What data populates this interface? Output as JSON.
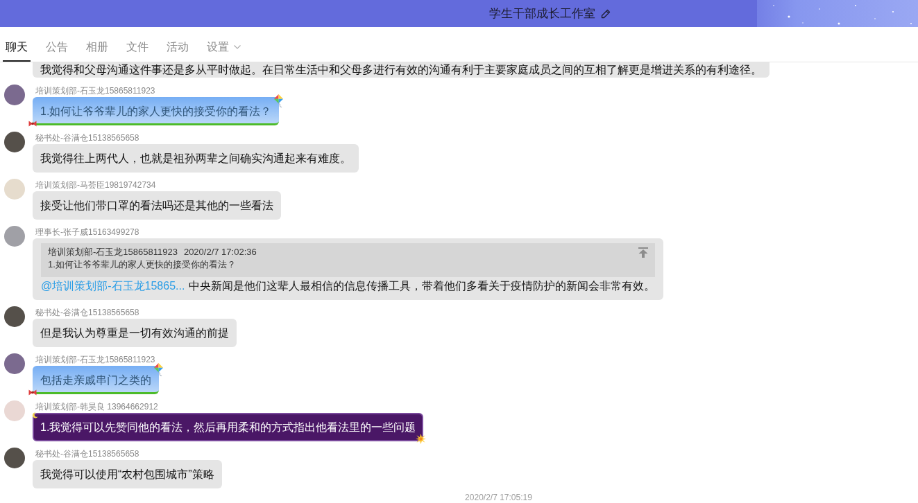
{
  "header": {
    "title": "学生干部成长工作室"
  },
  "tabs": [
    {
      "label": "聊天",
      "selected": true,
      "has_menu": false
    },
    {
      "label": "公告",
      "selected": false,
      "has_menu": false
    },
    {
      "label": "相册",
      "selected": false,
      "has_menu": false
    },
    {
      "label": "文件",
      "selected": false,
      "has_menu": false
    },
    {
      "label": "活动",
      "selected": false,
      "has_menu": false
    },
    {
      "label": "设置",
      "selected": false,
      "has_menu": true
    }
  ],
  "chat": {
    "messages": [
      {
        "kind": "plain",
        "text": "我觉得和父母沟通这件事还是多从平时做起。在日常生活中和父母多进行有效的沟通有利于主要家庭成员之间的互相了解更是增进关系的有利途径。"
      },
      {
        "kind": "sky",
        "sender": "培训策划部-石玉龙15865811923",
        "avatar": {
          "color": "#7b6a8f"
        },
        "text": "1.如何让爷爷辈儿的家人更快的接受你的看法？"
      },
      {
        "kind": "plain",
        "sender": "秘书处-谷满仓15138565658",
        "avatar": {
          "color": "#55504a"
        },
        "text": "我觉得往上两代人，也就是祖孙两辈之间确实沟通起来有难度。"
      },
      {
        "kind": "plain",
        "sender": "培训策划部-马荟臣19819742734",
        "avatar": {
          "color": "#e6dccd"
        },
        "text": "接受让他们带口罩的看法吗还是其他的一些看法"
      },
      {
        "kind": "plain",
        "sender": "理事长-张子威15163499278",
        "avatar": {
          "color": "#a0a0a6"
        },
        "quote": {
          "sender": "培训策划部-石玉龙15865811923",
          "time": "2020/2/7 17:02:36",
          "text": "1.如何让爷爷辈儿的家人更快的接受你的看法？"
        },
        "mention": "@培训策划部-石玉龙15865...",
        "text": "中央新闻是他们这辈人最相信的信息传播工具，带着他们多看关于疫情防护的新闻会非常有效。"
      },
      {
        "kind": "plain",
        "sender": "秘书处-谷满仓15138565658",
        "avatar": {
          "color": "#55504a"
        },
        "text": "但是我认为尊重是一切有效沟通的前提"
      },
      {
        "kind": "sky",
        "sender": "培训策划部-石玉龙15865811923",
        "avatar": {
          "color": "#7b6a8f"
        },
        "text": "包括走亲戚串门之类的"
      },
      {
        "kind": "night",
        "sender": "培训策划部-韩昊良 13964662912",
        "avatar": {
          "color": "#ead8d4"
        },
        "text": "1.我觉得可以先赞同他的看法，然后再用柔和的方式指出他看法里的一些问题"
      },
      {
        "kind": "plain",
        "sender": "秘书处-谷满仓15138565658",
        "avatar": {
          "color": "#55504a"
        },
        "text": "我觉得可以使用“农村包围城市”策略"
      }
    ],
    "timestamp": "2020/2/7 17:05:19"
  }
}
